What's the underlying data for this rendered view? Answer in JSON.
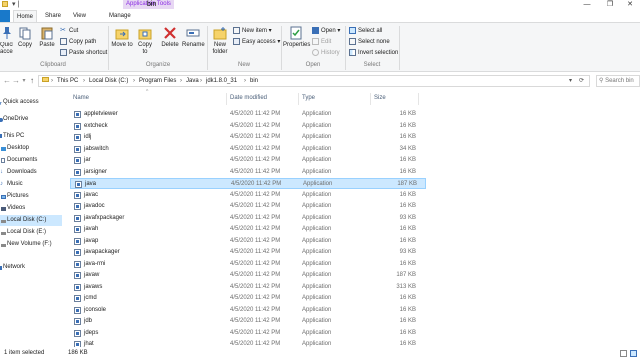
{
  "window": {
    "context_tab": "Application Tools",
    "title": "bin"
  },
  "tabs": {
    "file": "",
    "home": "Home",
    "share": "Share",
    "view": "View",
    "manage": "Manage"
  },
  "ribbon": {
    "quick_access": "Quick access",
    "copy": "Copy",
    "paste": "Paste",
    "cut": "Cut",
    "copy_path": "Copy path",
    "paste_shortcut": "Paste shortcut",
    "move_to": "Move to",
    "copy_to": "Copy to",
    "delete": "Delete",
    "rename": "Rename",
    "new_folder": "New folder",
    "new_item": "New item",
    "easy_access": "Easy access",
    "properties": "Properties",
    "open": "Open",
    "edit": "Edit",
    "history": "History",
    "select_all": "Select all",
    "select_none": "Select none",
    "invert_selection": "Invert selection",
    "groups": {
      "clipboard": "Clipboard",
      "organize": "Organize",
      "new": "New",
      "open": "Open",
      "select": "Select"
    }
  },
  "address": {
    "crumbs": [
      "This PC",
      "Local Disk (C:)",
      "Program Files",
      "Java",
      "jdk1.8.0_31",
      "bin"
    ],
    "search_placeholder": "Search bin"
  },
  "nav_pane": {
    "items": [
      {
        "label": "Quick access",
        "icon": "star-icon"
      },
      {
        "label": "OneDrive",
        "icon": "cloud-icon"
      },
      {
        "label": "This PC",
        "icon": "computer-icon"
      },
      {
        "label": "Desktop",
        "icon": "desktop-icon"
      },
      {
        "label": "Documents",
        "icon": "documents-icon"
      },
      {
        "label": "Downloads",
        "icon": "downloads-icon"
      },
      {
        "label": "Music",
        "icon": "music-icon"
      },
      {
        "label": "Pictures",
        "icon": "pictures-icon"
      },
      {
        "label": "Videos",
        "icon": "videos-icon"
      },
      {
        "label": "Local Disk (C:)",
        "icon": "drive-icon"
      },
      {
        "label": "Local Disk (E:)",
        "icon": "drive-icon"
      },
      {
        "label": "New Volume (F:)",
        "icon": "drive-icon"
      },
      {
        "label": "Network",
        "icon": "network-icon"
      }
    ]
  },
  "columns": {
    "name": "Name",
    "date": "Date modified",
    "type": "Type",
    "size": "Size"
  },
  "files": [
    {
      "name": "appletviewer",
      "date": "4/5/2020 11:42 PM",
      "type": "Application",
      "size": "16 KB"
    },
    {
      "name": "extcheck",
      "date": "4/5/2020 11:42 PM",
      "type": "Application",
      "size": "16 KB"
    },
    {
      "name": "idlj",
      "date": "4/5/2020 11:42 PM",
      "type": "Application",
      "size": "16 KB"
    },
    {
      "name": "jabswitch",
      "date": "4/5/2020 11:42 PM",
      "type": "Application",
      "size": "34 KB"
    },
    {
      "name": "jar",
      "date": "4/5/2020 11:42 PM",
      "type": "Application",
      "size": "16 KB"
    },
    {
      "name": "jarsigner",
      "date": "4/5/2020 11:42 PM",
      "type": "Application",
      "size": "16 KB"
    },
    {
      "name": "java",
      "date": "4/5/2020 11:42 PM",
      "type": "Application",
      "size": "187 KB"
    },
    {
      "name": "javac",
      "date": "4/5/2020 11:42 PM",
      "type": "Application",
      "size": "16 KB"
    },
    {
      "name": "javadoc",
      "date": "4/5/2020 11:42 PM",
      "type": "Application",
      "size": "16 KB"
    },
    {
      "name": "javafxpackager",
      "date": "4/5/2020 11:42 PM",
      "type": "Application",
      "size": "93 KB"
    },
    {
      "name": "javah",
      "date": "4/5/2020 11:42 PM",
      "type": "Application",
      "size": "16 KB"
    },
    {
      "name": "javap",
      "date": "4/5/2020 11:42 PM",
      "type": "Application",
      "size": "16 KB"
    },
    {
      "name": "javapackager",
      "date": "4/5/2020 11:42 PM",
      "type": "Application",
      "size": "93 KB"
    },
    {
      "name": "java-rmi",
      "date": "4/5/2020 11:42 PM",
      "type": "Application",
      "size": "16 KB"
    },
    {
      "name": "javaw",
      "date": "4/5/2020 11:42 PM",
      "type": "Application",
      "size": "187 KB"
    },
    {
      "name": "javaws",
      "date": "4/5/2020 11:42 PM",
      "type": "Application",
      "size": "313 KB"
    },
    {
      "name": "jcmd",
      "date": "4/5/2020 11:42 PM",
      "type": "Application",
      "size": "16 KB"
    },
    {
      "name": "jconsole",
      "date": "4/5/2020 11:42 PM",
      "type": "Application",
      "size": "16 KB"
    },
    {
      "name": "jdb",
      "date": "4/5/2020 11:42 PM",
      "type": "Application",
      "size": "16 KB"
    },
    {
      "name": "jdeps",
      "date": "4/5/2020 11:42 PM",
      "type": "Application",
      "size": "16 KB"
    },
    {
      "name": "jhat",
      "date": "4/5/2020 11:42 PM",
      "type": "Application",
      "size": "16 KB"
    }
  ],
  "selected_file": "java",
  "status": {
    "count": "1 item selected",
    "size": "186 KB"
  },
  "colors": {
    "selection": "#cce8ff",
    "selection_border": "#99d1ff",
    "file_tab": "#1979ca",
    "context_tab": "#8a2be2"
  }
}
